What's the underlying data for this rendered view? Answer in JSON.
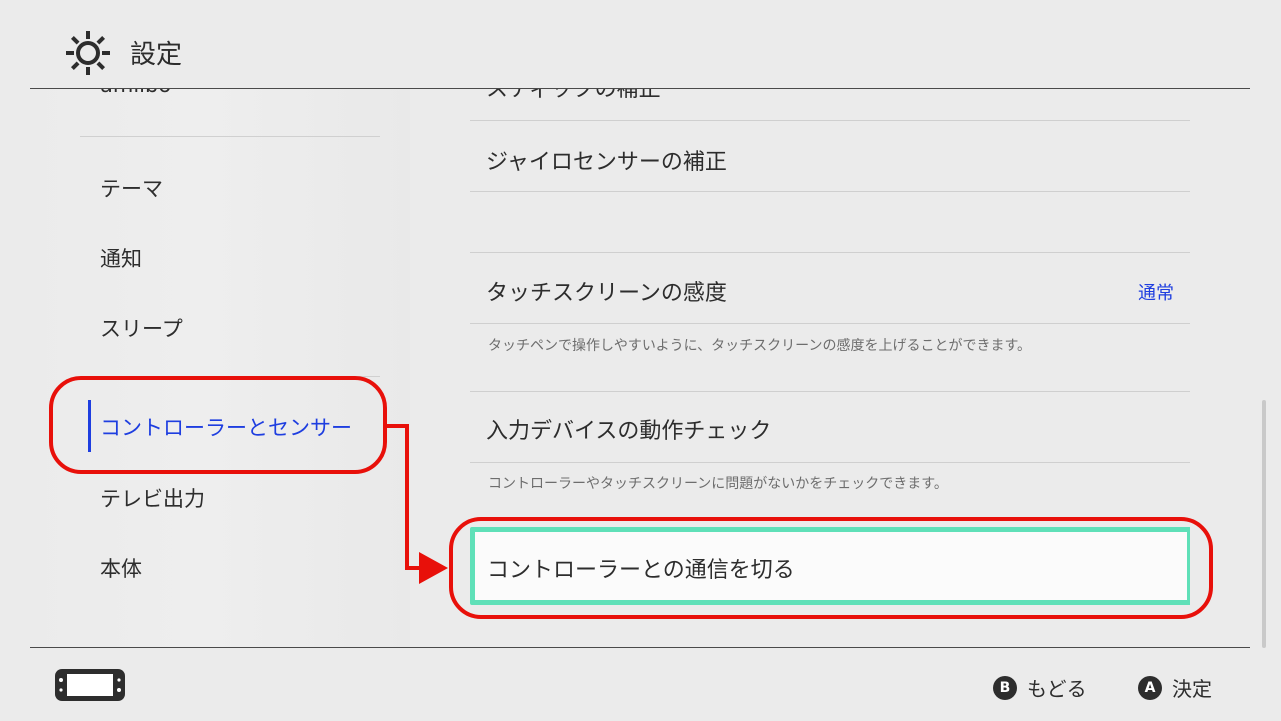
{
  "header": {
    "title": "設定",
    "icon": "gear-icon"
  },
  "sidebar": {
    "partial_top": "amiibo",
    "items": [
      {
        "label": "テーマ"
      },
      {
        "label": "通知"
      },
      {
        "label": "スリープ"
      },
      {
        "label": "コントローラーとセンサー",
        "active": true
      },
      {
        "label": "テレビ出力"
      },
      {
        "label": "本体"
      }
    ]
  },
  "main": {
    "partial_top": "スティックの補正",
    "rows": [
      {
        "label": "ジャイロセンサーの補正"
      },
      {
        "label": "タッチスクリーンの感度",
        "value": "通常",
        "description": "タッチペンで操作しやすいように、タッチスクリーンの感度を上げることができます。"
      },
      {
        "label": "入力デバイスの動作チェック",
        "description": "コントローラーやタッチスクリーンに問題がないかをチェックできます。"
      },
      {
        "label": "コントローラーとの通信を切る",
        "selected": true
      }
    ]
  },
  "footer": {
    "back": {
      "button": "B",
      "label": "もどる"
    },
    "ok": {
      "button": "A",
      "label": "決定"
    }
  },
  "colors": {
    "accent": "#1e3ee0",
    "selection": "#5fe0b8",
    "annotation": "#e8100a",
    "background": "#ebebeb"
  }
}
